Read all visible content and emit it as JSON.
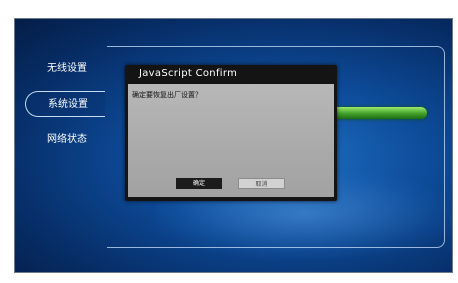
{
  "sidebar": {
    "items": [
      {
        "label": "无线设置",
        "active": false
      },
      {
        "label": "系统设置",
        "active": true
      },
      {
        "label": "网络状态",
        "active": false
      }
    ]
  },
  "dialog": {
    "title": "JavaScript Confirm",
    "message": "确定要恢复出厂设置？",
    "ok_label": "确定",
    "cancel_label": "取消"
  },
  "colors": {
    "background": "#0d4b99",
    "progress_green": "#3fa02a",
    "dialog_title_bg": "#141414",
    "dialog_body_bg": "#adadad"
  }
}
